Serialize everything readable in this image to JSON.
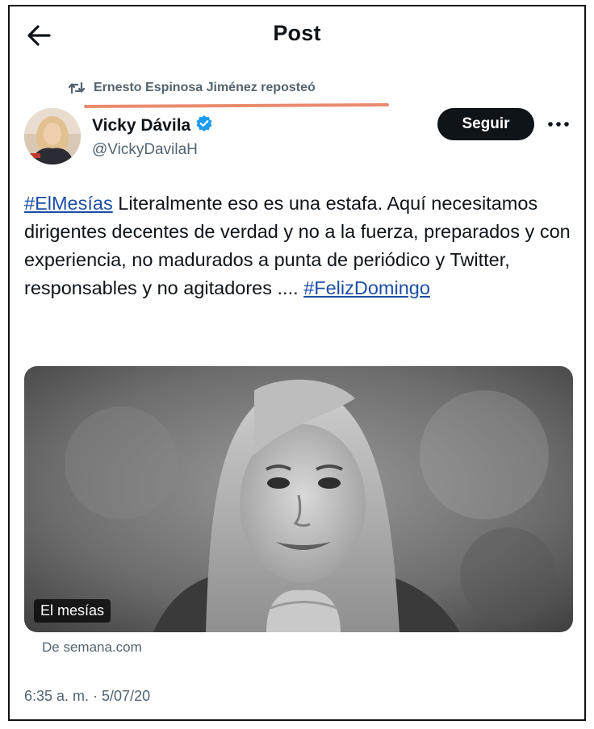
{
  "header": {
    "title": "Post",
    "back_icon": "arrow-left-icon"
  },
  "repost": {
    "icon": "repost-icon",
    "text": "Ernesto Espinosa Jiménez reposteó"
  },
  "author": {
    "display_name": "Vicky Dávila",
    "handle": "@VickyDavilaH",
    "verified_icon": "verified-badge-icon"
  },
  "actions": {
    "follow_label": "Seguir",
    "more_icon": "more-options-icon"
  },
  "tweet": {
    "hashtag_1": "#ElMesías",
    "body": " Literalmente eso es una estafa. Aquí necesitamos dirigentes decentes de verdad y no a la fuerza, preparados y con experiencia, no madurados a punta de periódico y Twitter, responsables y no agitadores .... ",
    "hashtag_2": "#FelizDomingo"
  },
  "media": {
    "caption": "El mesías",
    "source": "De semana.com"
  },
  "meta": {
    "timestamp": "6:35 a. m. · 5/07/20"
  },
  "colors": {
    "hashtag": "#1d4ea6",
    "secondary_text": "#536471",
    "follow_button_bg": "#0f1419",
    "verified_badge": "#1d9bf0",
    "annotation_underline": "#e98b6e"
  }
}
